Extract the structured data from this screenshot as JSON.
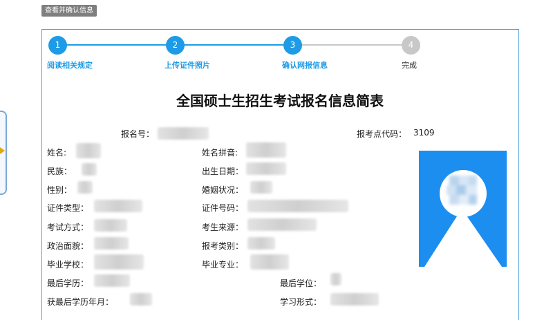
{
  "top_button": "查看并确认信息",
  "steps": [
    {
      "num": "1",
      "label": "阅读相关规定",
      "state": "done"
    },
    {
      "num": "2",
      "label": "上传证件照片",
      "state": "done"
    },
    {
      "num": "3",
      "label": "确认网报信息",
      "state": "current"
    },
    {
      "num": "4",
      "label": "完成",
      "state": "pending"
    }
  ],
  "colors": {
    "accent": "#1e9be6",
    "pending": "#c8c8c8",
    "photo_bg": "#1c8ef0",
    "button_bg": "#7f7f7f"
  },
  "form": {
    "title": "全国硕士生招生考试报名信息简表",
    "reg_no_label": "报名号：",
    "site_code_label": "报考点代码：",
    "site_code_value": "3109",
    "fields": {
      "name": "姓名:",
      "pinyin": "姓名拼音:",
      "ethnicity": "民族：",
      "birthdate": "出生日期：",
      "gender": "性别：",
      "marital": "婚姻状况：",
      "id_type": "证件类型：",
      "id_no": "证件号码：",
      "exam_mode": "考试方式：",
      "source": "考生来源：",
      "political": "政治面貌：",
      "category": "报考类别：",
      "school": "毕业学校：",
      "major": "毕业专业：",
      "last_edu": "最后学历：",
      "last_degree": "最后学位：",
      "edu_date": "获最后学历年月：",
      "study_form": "学习形式："
    }
  }
}
